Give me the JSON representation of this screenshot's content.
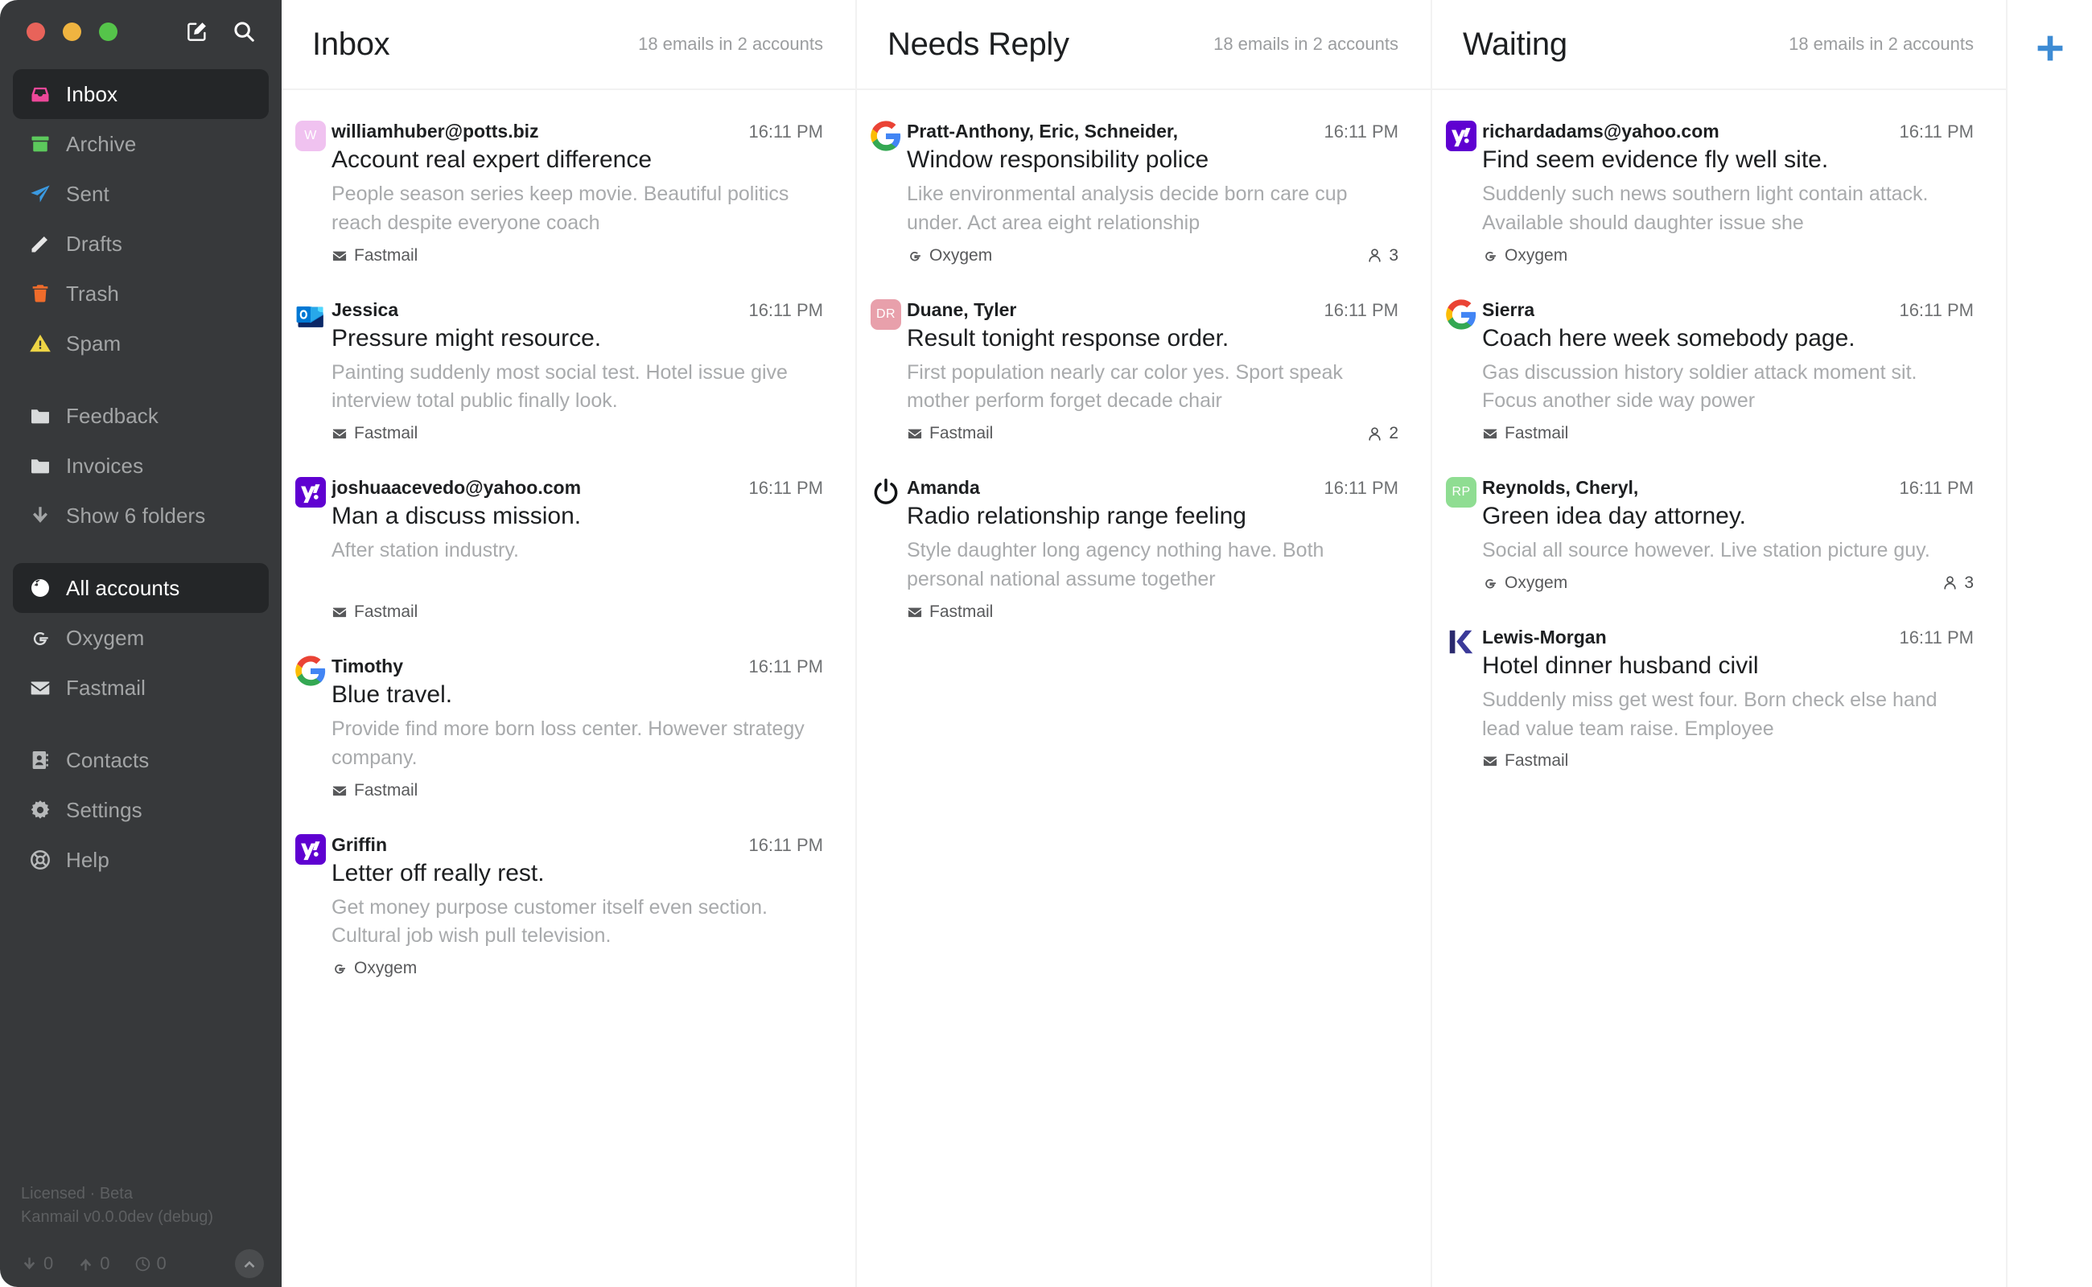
{
  "window": {
    "traffic_lights": [
      "close",
      "minimize",
      "maximize"
    ],
    "compose_icon": "compose-icon",
    "search_icon": "search-icon"
  },
  "sidebar": {
    "folders": [
      {
        "label": "Inbox",
        "icon": "inbox-icon",
        "color": "#ec4899",
        "active": true
      },
      {
        "label": "Archive",
        "icon": "archive-icon",
        "color": "#5cc95c",
        "active": false
      },
      {
        "label": "Sent",
        "icon": "sent-icon",
        "color": "#3b9ae1",
        "active": false
      },
      {
        "label": "Drafts",
        "icon": "pencil-icon",
        "color": "#e6e6e6",
        "active": false
      },
      {
        "label": "Trash",
        "icon": "trash-icon",
        "color": "#ef6c2b",
        "active": false
      },
      {
        "label": "Spam",
        "icon": "warning-icon",
        "color": "#edd445",
        "active": false
      }
    ],
    "custom_folders": [
      {
        "label": "Feedback",
        "icon": "folder-icon",
        "color": "#d8dadb",
        "active": false
      },
      {
        "label": "Invoices",
        "icon": "folder-icon",
        "color": "#d8dadb",
        "active": false
      }
    ],
    "show_more": {
      "label": "Show 6 folders",
      "icon": "arrow-down-icon",
      "color": "#a3a5a6"
    },
    "accounts": [
      {
        "label": "All accounts",
        "icon": "globe-icon",
        "color": "#ffffff",
        "active": true
      },
      {
        "label": "Oxygem",
        "icon": "google-g-icon",
        "color": "#d8dadb",
        "active": false
      },
      {
        "label": "Fastmail",
        "icon": "envelope-icon",
        "color": "#d8dadb",
        "active": false
      }
    ],
    "tools": [
      {
        "label": "Contacts",
        "icon": "contacts-icon",
        "color": "#b7b9ba",
        "active": false
      },
      {
        "label": "Settings",
        "icon": "gear-icon",
        "color": "#b7b9ba",
        "active": false
      },
      {
        "label": "Help",
        "icon": "lifebuoy-icon",
        "color": "#b7b9ba",
        "active": false
      }
    ],
    "license": "Licensed · Beta",
    "version": "Kanmail v0.0.0dev (debug)",
    "status": {
      "download_count": "0",
      "upload_count": "0",
      "pending_count": "0",
      "sync_icon": "chevron-up-circle-icon"
    }
  },
  "columns": [
    {
      "title": "Inbox",
      "count": "18 emails in 2 accounts",
      "emails": [
        {
          "from": "williamhuber@potts.biz",
          "time": "16:11 PM",
          "subject": "Account real expert difference",
          "excerpt": "People season series keep movie. Beautiful politics reach despite everyone coach",
          "account": "Fastmail",
          "account_icon": "envelope-icon",
          "badge": "letter",
          "badge_letters": "W",
          "badge_color": "#f0c2f0",
          "recipients": ""
        },
        {
          "from": "Jessica",
          "time": "16:11 PM",
          "subject": "Pressure might resource.",
          "excerpt": "Painting suddenly most social test. Hotel issue give interview total public finally look.",
          "account": "Fastmail",
          "account_icon": "envelope-icon",
          "badge": "outlook",
          "badge_letters": "",
          "badge_color": "",
          "recipients": ""
        },
        {
          "from": "joshuaacevedo@yahoo.com",
          "time": "16:11 PM",
          "subject": "Man a discuss mission.",
          "excerpt": "After station industry.",
          "account": "Fastmail",
          "account_icon": "envelope-icon",
          "badge": "yahoo",
          "badge_letters": "",
          "badge_color": "",
          "recipients": ""
        },
        {
          "from": "Timothy",
          "time": "16:11 PM",
          "subject": "Blue travel.",
          "excerpt": "Provide find more born loss center. However strategy company.",
          "account": "Fastmail",
          "account_icon": "envelope-icon",
          "badge": "google",
          "badge_letters": "",
          "badge_color": "",
          "recipients": ""
        },
        {
          "from": "Griffin",
          "time": "16:11 PM",
          "subject": "Letter off really rest.",
          "excerpt": "Get money purpose customer itself even section. Cultural job wish pull television.",
          "account": "Oxygem",
          "account_icon": "google-g-icon",
          "badge": "yahoo",
          "badge_letters": "",
          "badge_color": "",
          "recipients": ""
        }
      ]
    },
    {
      "title": "Needs Reply",
      "count": "18 emails in 2 accounts",
      "emails": [
        {
          "from": "Pratt-Anthony, Eric, Schneider,",
          "time": "16:11 PM",
          "subject": "Window responsibility police",
          "excerpt": "Like environmental analysis decide born care cup under. Act area eight relationship",
          "account": "Oxygem",
          "account_icon": "google-g-icon",
          "badge": "google",
          "badge_letters": "",
          "badge_color": "",
          "recipients": "3"
        },
        {
          "from": "Duane, Tyler",
          "time": "16:11 PM",
          "subject": "Result tonight response order.",
          "excerpt": "First population nearly car color yes. Sport speak mother perform forget decade chair",
          "account": "Fastmail",
          "account_icon": "envelope-icon",
          "badge": "letter",
          "badge_letters": "DR",
          "badge_color": "#e8a0ab",
          "recipients": "2"
        },
        {
          "from": "Amanda",
          "time": "16:11 PM",
          "subject": "Radio relationship range feeling",
          "excerpt": "Style daughter long agency nothing have. Both personal national assume together",
          "account": "Fastmail",
          "account_icon": "envelope-icon",
          "badge": "power",
          "badge_letters": "",
          "badge_color": "",
          "recipients": ""
        }
      ]
    },
    {
      "title": "Waiting",
      "count": "18 emails in 2 accounts",
      "emails": [
        {
          "from": "richardadams@yahoo.com",
          "time": "16:11 PM",
          "subject": "Find seem evidence fly well site.",
          "excerpt": "Suddenly such news southern light contain attack. Available should daughter issue she",
          "account": "Oxygem",
          "account_icon": "google-g-icon",
          "badge": "yahoo",
          "badge_letters": "",
          "badge_color": "",
          "recipients": ""
        },
        {
          "from": "Sierra",
          "time": "16:11 PM",
          "subject": "Coach here week somebody page.",
          "excerpt": "Gas discussion history soldier attack moment sit. Focus another side way power",
          "account": "Fastmail",
          "account_icon": "envelope-icon",
          "badge": "google",
          "badge_letters": "",
          "badge_color": "",
          "recipients": ""
        },
        {
          "from": "Reynolds, Cheryl,",
          "time": "16:11 PM",
          "subject": "Green idea day attorney.",
          "excerpt": "Social all source however. Live station picture guy.",
          "account": "Oxygem",
          "account_icon": "google-g-icon",
          "badge": "letter",
          "badge_letters": "RP",
          "badge_color": "#8fdd92",
          "recipients": "3"
        },
        {
          "from": "Lewis-Morgan",
          "time": "16:11 PM",
          "subject": "Hotel dinner husband civil",
          "excerpt": "Suddenly miss get west four. Born check else hand lead value team raise. Employee",
          "account": "Fastmail",
          "account_icon": "envelope-icon",
          "badge": "klarna",
          "badge_letters": "",
          "badge_color": "",
          "recipients": ""
        }
      ]
    }
  ],
  "add_column": {
    "icon": "plus-icon",
    "color": "#3d8bd4"
  }
}
